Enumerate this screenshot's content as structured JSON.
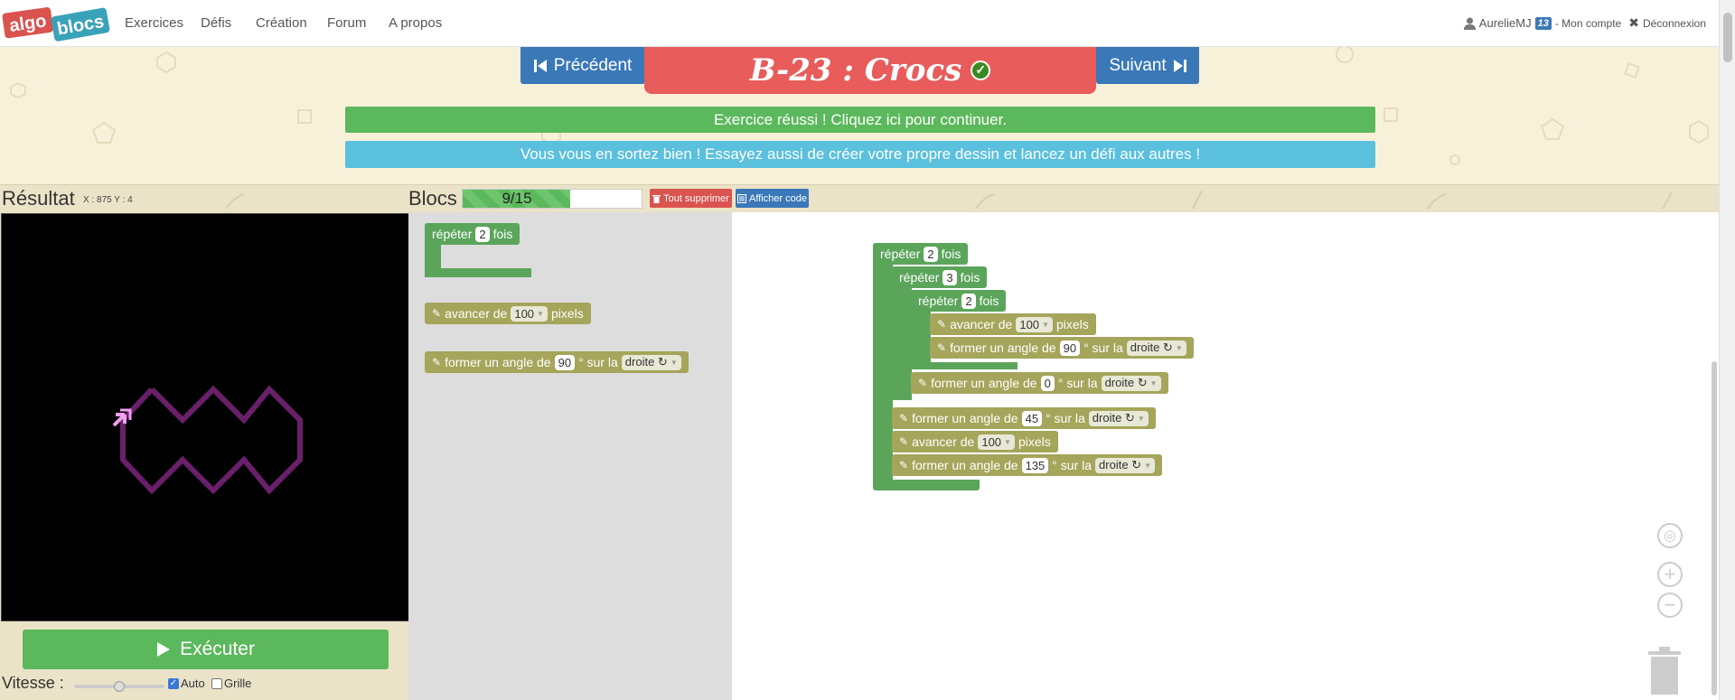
{
  "nav": {
    "logo_word1": "algo",
    "logo_word2": "blocs",
    "links": [
      "Exercices",
      "Défis",
      "Création",
      "Forum",
      "A propos"
    ],
    "user": "AurelieMJ",
    "badge": "13",
    "account": "- Mon compte",
    "logout": "Déconnexion"
  },
  "header": {
    "prev": "Précédent",
    "next": "Suivant",
    "title": "B-23 : Crocs",
    "success": "Exercice réussi ! Cliquez ici pour continuer.",
    "info": "Vous vous en sortez bien ! Essayez aussi de créer votre propre dessin et lancez un défi aux autres !"
  },
  "result": {
    "title": "Résultat",
    "coords": "X : 875 Y : 4",
    "run": "Exécuter",
    "speed_label": "Vitesse :",
    "speed_level": 0.5,
    "auto_label": "Auto",
    "auto_checked": true,
    "grid_label": "Grille",
    "grid_checked": false
  },
  "blocks": {
    "title": "Blocs",
    "used": 9,
    "max": 15,
    "counter": "9/15",
    "delete_all": "Tout supprimer",
    "show_code": "Afficher code"
  },
  "labels": {
    "repeat": "répéter",
    "times": "fois",
    "forward": "avancer de",
    "pixels": "pixels",
    "angle": "former un angle de",
    "degrees_on": "° sur la",
    "right": "droite ↻"
  },
  "toolbox": {
    "repeat_value": "2",
    "forward_value": "100",
    "angle_value": "90"
  },
  "program": {
    "outer_repeat": "2",
    "mid_repeat": "3",
    "inner_repeat": "2",
    "inner_forward": "100",
    "inner_angle": "90",
    "mid_angle": "0",
    "angle_a": "45",
    "forward_b": "100",
    "angle_c": "135"
  },
  "colors": {
    "primary": "#3a78b8",
    "success": "#5cb85c",
    "info": "#5bc0de",
    "danger": "#d9534f",
    "title_red": "#e85c5c",
    "block_green": "#5ba55b",
    "block_olive": "#a5a55b",
    "drawing": "#6a1f6a",
    "turtle": "#f0a0f0"
  },
  "icons": {
    "prev": "step-backward-icon",
    "next": "step-forward-icon",
    "check": "check-circle-icon",
    "user": "user-icon",
    "logout": "times-icon",
    "trash": "trash-icon",
    "code": "code-list-icon",
    "play": "play-icon",
    "pencil": "pencil-icon"
  }
}
